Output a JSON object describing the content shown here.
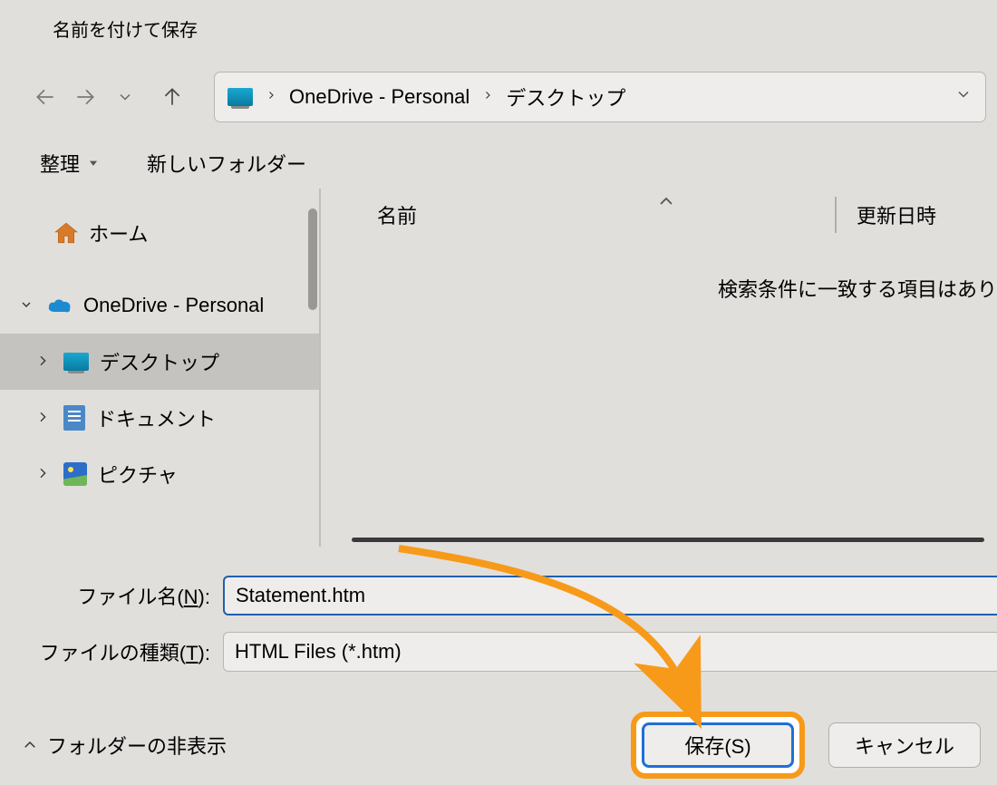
{
  "title": "名前を付けて保存",
  "breadcrumb": {
    "item1": "OneDrive - Personal",
    "item2": "デスクトップ"
  },
  "toolbar": {
    "organize": "整理",
    "new_folder": "新しいフォルダー"
  },
  "sidebar": {
    "home": "ホーム",
    "onedrive": "OneDrive - Personal",
    "desktop": "デスクトップ",
    "documents": "ドキュメント",
    "pictures": "ピクチャ"
  },
  "columns": {
    "name": "名前",
    "date": "更新日時"
  },
  "empty_message": "検索条件に一致する項目はあり",
  "form": {
    "filename_label_pre": "ファイル名(",
    "filename_accel": "N",
    "filename_label_post": "):",
    "filename_value": "Statement.htm",
    "filetype_label_pre": "ファイルの種類(",
    "filetype_accel": "T",
    "filetype_label_post": "):",
    "filetype_value": "HTML Files (*.htm)"
  },
  "footer": {
    "hide_folders": "フォルダーの非表示",
    "save": "保存(S)",
    "cancel": "キャンセル"
  }
}
